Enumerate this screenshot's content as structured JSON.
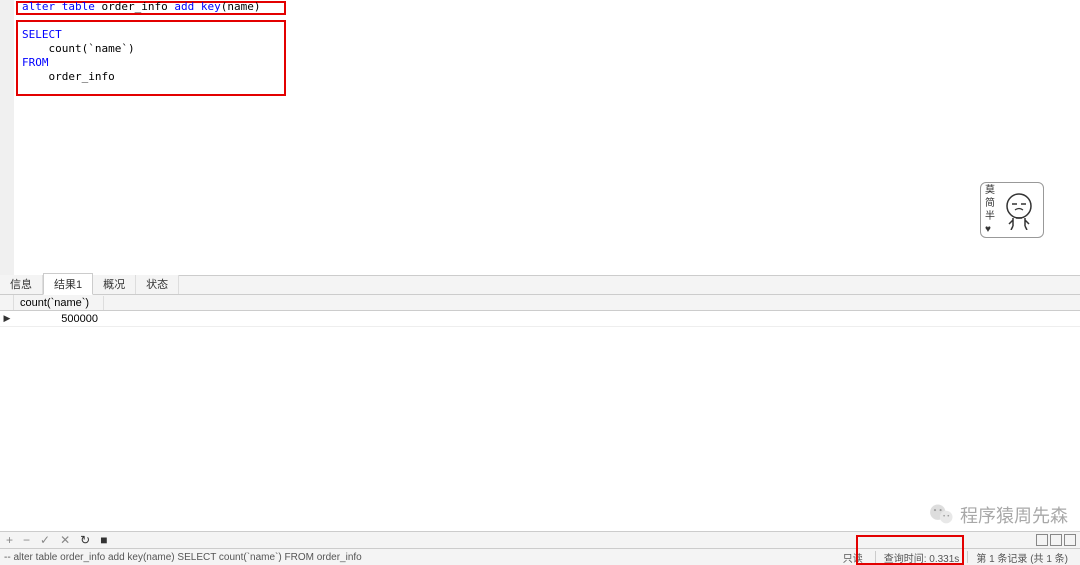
{
  "editor": {
    "line1_kw_alter": "alter table",
    "line1_ident": " order_info ",
    "line1_kw_add": "add key",
    "line1_paren": "(name)",
    "line2_select": "SELECT",
    "line3_count": "    count(`name`)",
    "line4_from": "FROM",
    "line5_table": "    order_info"
  },
  "sticker": {
    "text": "莫\n简\n半\n♥"
  },
  "tabs": {
    "info": "信息",
    "result1": "结果1",
    "profile": "概况",
    "status": "状态"
  },
  "grid": {
    "header": "count(`name`)",
    "value": "500000",
    "indicator": "▶"
  },
  "watermark": {
    "text": "程序猿周先森"
  },
  "toolbar": {
    "plus": "+",
    "minus": "−",
    "check": "✓",
    "cross": "✕",
    "refresh": "↻",
    "stop": "■"
  },
  "status": {
    "query": "-- alter table order_info add key(name) SELECT count(`name`) FROM          order_info",
    "readonly": "只读",
    "query_time": "查询时间: 0.331s",
    "records": "第 1 条记录 (共 1 条)"
  }
}
